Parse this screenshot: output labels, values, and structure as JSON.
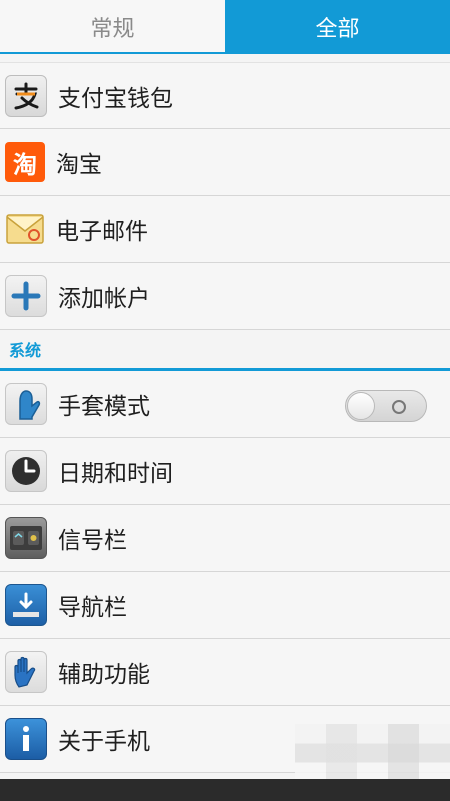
{
  "tabs": [
    {
      "label": "常规",
      "active": false
    },
    {
      "label": "全部",
      "active": true
    }
  ],
  "accounts": [
    {
      "label": "支付宝钱包",
      "icon": "alipay-icon"
    },
    {
      "label": "淘宝",
      "icon": "taobao-icon"
    },
    {
      "label": "电子邮件",
      "icon": "email-icon"
    },
    {
      "label": "添加帐户",
      "icon": "add-icon"
    }
  ],
  "section_system": {
    "title": "系统"
  },
  "system": [
    {
      "label": "手套模式",
      "icon": "glove-icon",
      "toggle": false
    },
    {
      "label": "日期和时间",
      "icon": "clock-icon"
    },
    {
      "label": "信号栏",
      "icon": "signal-bar-icon"
    },
    {
      "label": "导航栏",
      "icon": "navigation-bar-icon"
    },
    {
      "label": "辅助功能",
      "icon": "hand-icon"
    },
    {
      "label": "关于手机",
      "icon": "info-icon"
    }
  ],
  "colors": {
    "accent": "#129ad6",
    "text": "#1f1f1f",
    "inactive_tab": "#8a8a8a"
  }
}
